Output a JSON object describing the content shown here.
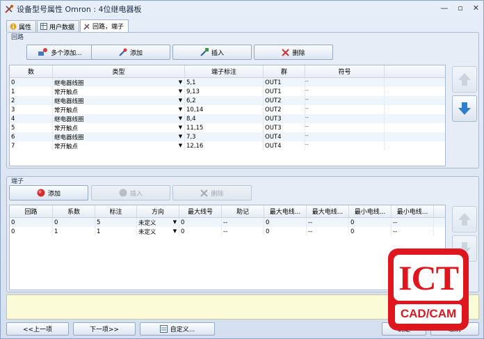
{
  "window": {
    "title": "设备型号属性 Omron : 4位继电器板",
    "controls": [
      "—",
      "▫",
      "✕"
    ]
  },
  "tabs": [
    {
      "label": "属性",
      "icon": "info-icon"
    },
    {
      "label": "用户数据",
      "icon": "table-icon"
    },
    {
      "label": "回路，端子",
      "icon": "circuit-icon",
      "active": true
    }
  ],
  "loops": {
    "group_title": "回路",
    "buttons": {
      "add_multiple": "多个添加...",
      "add": "添加",
      "insert": "插入",
      "delete": "删除"
    },
    "columns": [
      "数",
      "类型",
      "端子标注",
      "群",
      "符号"
    ],
    "rows": [
      {
        "num": "0",
        "type": "继电器线圈",
        "terminal": "5,1",
        "group": "OUT1",
        "symbol": "--"
      },
      {
        "num": "1",
        "type": "常开触点",
        "terminal": "9,13",
        "group": "OUT1",
        "symbol": "--"
      },
      {
        "num": "2",
        "type": "继电器线圈",
        "terminal": "6,2",
        "group": "OUT2",
        "symbol": "--"
      },
      {
        "num": "3",
        "type": "常开触点",
        "terminal": "10,14",
        "group": "OUT2",
        "symbol": "--"
      },
      {
        "num": "4",
        "type": "继电器线圈",
        "terminal": "8,4",
        "group": "OUT3",
        "symbol": "--"
      },
      {
        "num": "5",
        "type": "常开触点",
        "terminal": "11,15",
        "group": "OUT3",
        "symbol": "--"
      },
      {
        "num": "6",
        "type": "继电器线圈",
        "terminal": "7,3",
        "group": "OUT4",
        "symbol": "--"
      },
      {
        "num": "7",
        "type": "常开触点",
        "terminal": "12,16",
        "group": "OUT4",
        "symbol": "--"
      }
    ]
  },
  "terminals": {
    "group_title": "端子",
    "buttons": {
      "add": "添加",
      "insert": "插入",
      "delete": "删除"
    },
    "columns": [
      "回路",
      "系数",
      "标注",
      "方向",
      "最大线号",
      "助记",
      "最大电线...",
      "最大电线...",
      "最小电线...",
      "最小电线..."
    ],
    "rows": [
      {
        "loop": "0",
        "factor": "0",
        "label": "5",
        "dir": "未定义",
        "maxwire": "0",
        "mnemonic": "--",
        "c7": "0",
        "c8": "--",
        "c9": "0",
        "c10": "--"
      },
      {
        "loop": "0",
        "factor": "1",
        "label": "1",
        "dir": "未定义",
        "maxwire": "0",
        "mnemonic": "--",
        "c7": "0",
        "c8": "--",
        "c9": "0",
        "c10": "--"
      }
    ]
  },
  "footer": {
    "prev": "<<上一项",
    "next": "下一项>>",
    "custom": "自定义...",
    "ok": "确定",
    "cancel": "取消"
  },
  "logo": {
    "main": "ICT",
    "sub": "CAD/CAM"
  },
  "colors": {
    "accent_blue": "#2f7fd0",
    "logo_red": "#e0161e",
    "message_bar": "#fcfbd8"
  }
}
